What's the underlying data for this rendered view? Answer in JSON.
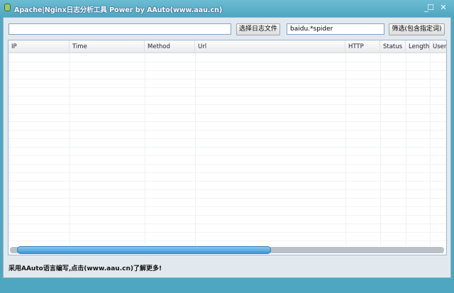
{
  "window": {
    "title": "Apache|Nginx日志分析工具 Power by AAuto(www.aau.cn)",
    "minimize": "_",
    "maximize": "☐",
    "close": "✕"
  },
  "toolbar": {
    "file_path_value": "",
    "choose_file_label": "选择日志文件",
    "filter_value": "baidu.*spider",
    "filter_label": "筛选(包含指定词)"
  },
  "table": {
    "columns": [
      "IP",
      "Time",
      "Method",
      "Url",
      "HTTP",
      "Status",
      "Length",
      "User"
    ],
    "rows": []
  },
  "scrollbar": {
    "horizontal_position": 0
  },
  "footer": {
    "text": "采用AAuto语言编写,点击(www.aau.cn)了解更多!"
  }
}
